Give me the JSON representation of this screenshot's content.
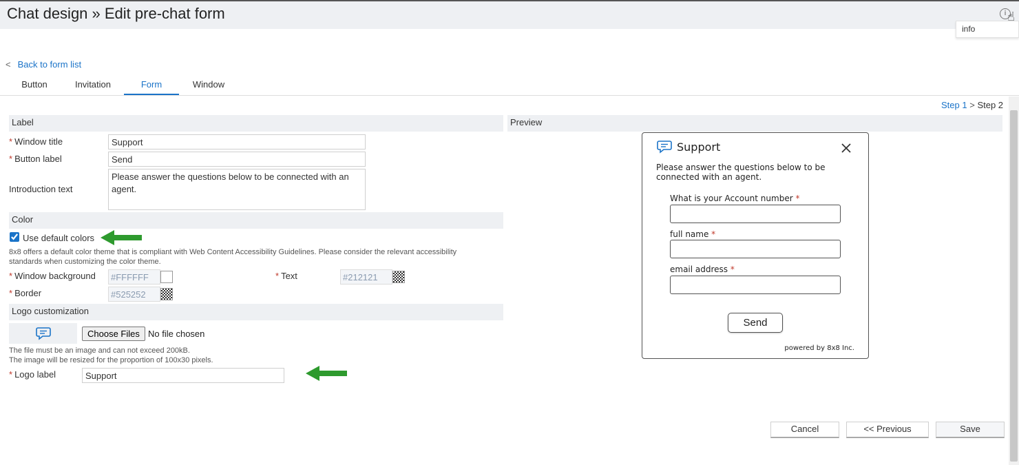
{
  "header": {
    "title": "Chat design » Edit pre-chat form",
    "info_icon": "info-icon",
    "info_tooltip": "info"
  },
  "nav": {
    "back_label": "Back to form list",
    "tabs": [
      {
        "label": "Button",
        "active": false
      },
      {
        "label": "Invitation",
        "active": false
      },
      {
        "label": "Form",
        "active": true
      },
      {
        "label": "Window",
        "active": false
      }
    ],
    "step1": "Step 1",
    "step_separator": ">",
    "step2": "Step 2"
  },
  "label_section": {
    "heading": "Label",
    "window_title_label": "Window title",
    "window_title_value": "Support",
    "button_label_label": "Button label",
    "button_label_value": "Send",
    "intro_label": "Introduction text",
    "intro_value": "Please answer the questions below to be connected with an agent."
  },
  "color_section": {
    "heading": "Color",
    "use_default_label": "Use default colors",
    "use_default_checked": true,
    "note": "8x8 offers a default color theme that is compliant with Web Content Accessibility Guidelines. Please consider the relevant accessibility standards when customizing the color theme.",
    "window_bg_label": "Window background",
    "window_bg_value": "#FFFFFF",
    "text_label": "Text",
    "text_value": "#212121",
    "border_label": "Border",
    "border_value": "#525252"
  },
  "logo_section": {
    "heading": "Logo customization",
    "logo_icon": "chat-bubble-icon",
    "choose_files_label": "Choose Files",
    "no_file_text": "No file chosen",
    "note_line1": "The file must be an image and can not exceed 200kB.",
    "note_line2": "The image will be resized for the proportion of 100x30 pixels.",
    "logo_label_label": "Logo label",
    "logo_label_value": "Support"
  },
  "preview": {
    "heading": "Preview",
    "title": "Support",
    "intro": "Please answer the questions below to be connected with an agent.",
    "fields": [
      {
        "label": "What is your Account number",
        "required": true
      },
      {
        "label": "full name",
        "required": true
      },
      {
        "label": "email address",
        "required": true
      }
    ],
    "send_label": "Send",
    "powered_by": "powered by 8x8 Inc."
  },
  "footer": {
    "cancel_label": "Cancel",
    "previous_label": "<< Previous",
    "save_label": "Save"
  },
  "colors": {
    "accent": "#1a73c8",
    "arrow": "#2e9a2e",
    "required": "#c0392b"
  }
}
